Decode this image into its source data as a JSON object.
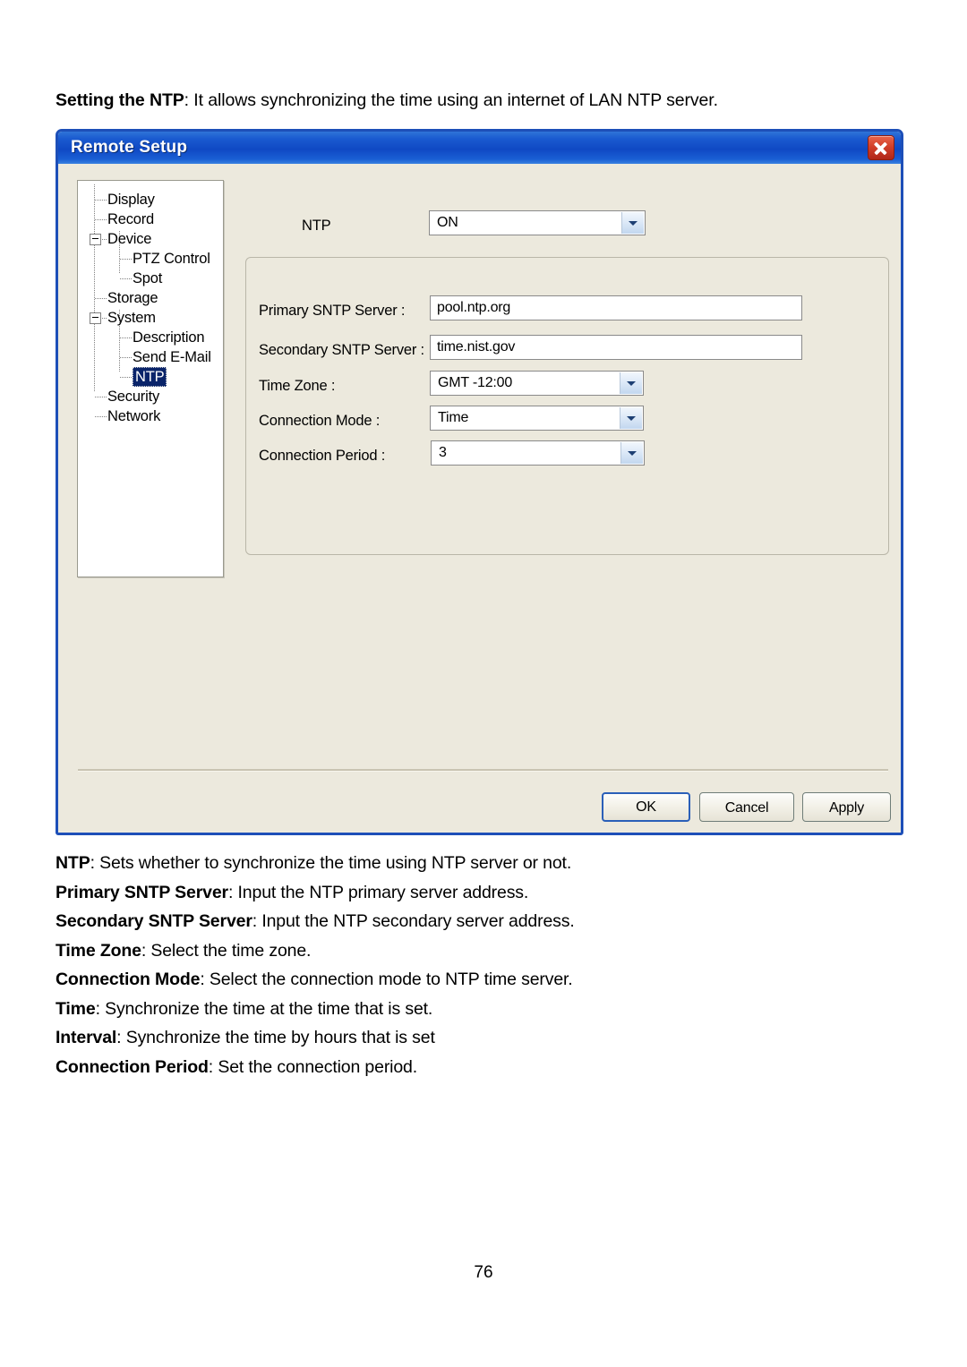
{
  "intro": {
    "bold": "Setting the NTP",
    "rest": ": It allows synchronizing the time using an internet of LAN NTP server."
  },
  "dialog": {
    "title": "Remote Setup",
    "close_icon": "close-icon",
    "tree": {
      "items": [
        {
          "label": "Display",
          "level": 1,
          "expander": false,
          "selected": false
        },
        {
          "label": "Record",
          "level": 1,
          "expander": false,
          "selected": false
        },
        {
          "label": "Device",
          "level": 1,
          "expander": true,
          "selected": false
        },
        {
          "label": "PTZ Control",
          "level": 2,
          "expander": false,
          "selected": false
        },
        {
          "label": "Spot",
          "level": 2,
          "expander": false,
          "selected": false
        },
        {
          "label": "Storage",
          "level": 1,
          "expander": false,
          "selected": false
        },
        {
          "label": "System",
          "level": 1,
          "expander": true,
          "selected": false
        },
        {
          "label": "Description",
          "level": 2,
          "expander": false,
          "selected": false
        },
        {
          "label": "Send E-Mail",
          "level": 2,
          "expander": false,
          "selected": false
        },
        {
          "label": "NTP",
          "level": 2,
          "expander": false,
          "selected": true
        },
        {
          "label": "Security",
          "level": 1,
          "expander": false,
          "selected": false
        },
        {
          "label": "Network",
          "level": 1,
          "expander": false,
          "selected": false
        }
      ]
    },
    "fields": {
      "ntp": {
        "label": "NTP",
        "value": "ON",
        "type": "select"
      },
      "primary_sntp": {
        "label": "Primary SNTP Server :",
        "value": "pool.ntp.org",
        "type": "text"
      },
      "secondary_sntp": {
        "label": "Secondary SNTP Server :",
        "value": "time.nist.gov",
        "type": "text"
      },
      "time_zone": {
        "label": "Time Zone :",
        "value": "GMT -12:00",
        "type": "select"
      },
      "connection_mode": {
        "label": "Connection Mode :",
        "value": "Time",
        "type": "select"
      },
      "connection_period": {
        "label": "Connection Period :",
        "value": "3",
        "type": "select"
      }
    },
    "buttons": {
      "ok": "OK",
      "cancel": "Cancel",
      "apply": "Apply"
    }
  },
  "descriptions": [
    {
      "term": "NTP",
      "text": ": Sets whether to synchronize the time using NTP server or not."
    },
    {
      "term": "Primary SNTP Server",
      "text": ": Input the NTP primary server address."
    },
    {
      "term": "Secondary SNTP Server",
      "text": ": Input the NTP secondary server address."
    },
    {
      "term": "Time Zone",
      "text": ": Select the time zone."
    },
    {
      "term": "Connection Mode",
      "text": ": Select the connection mode to NTP time server."
    },
    {
      "term": "Time",
      "text": ": Synchronize the time at the time that is set."
    },
    {
      "term": "Interval",
      "text": ": Synchronize the time by hours that is set"
    },
    {
      "term": "Connection Period",
      "text": ": Set the connection period."
    }
  ],
  "page_number": "76",
  "colors": {
    "titlebar": "#1a5ad0",
    "dialog_border": "#1d4fb8",
    "dialog_bg": "#ece9dd",
    "selection": "#0a246a",
    "close_button": "#d2402a"
  }
}
